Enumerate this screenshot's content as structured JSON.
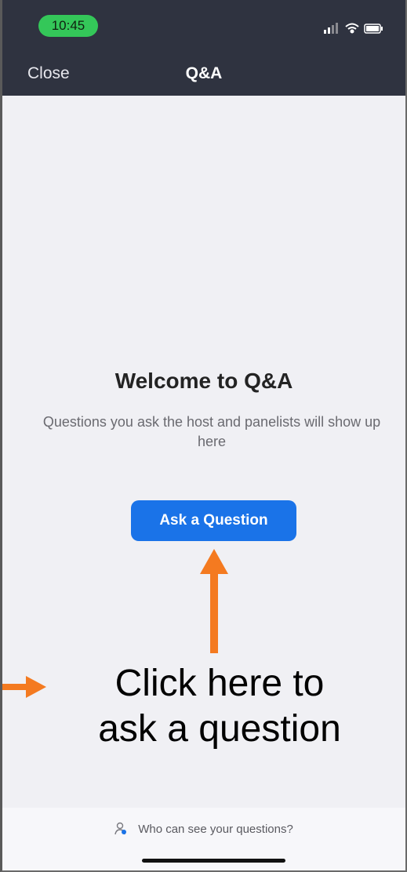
{
  "status_bar": {
    "time": "10:45",
    "icons": [
      "signal-icon",
      "wifi-icon",
      "battery-icon"
    ]
  },
  "nav": {
    "close_label": "Close",
    "title": "Q&A"
  },
  "empty_state": {
    "heading": "Welcome to Q&A",
    "description": "Questions you ask the host and panelists will show up here",
    "button_label": "Ask a Question"
  },
  "annotation": {
    "line1": "Click here to",
    "line2": "ask a question",
    "color": "#f47a20"
  },
  "footer": {
    "privacy_label": "Who can see your questions?",
    "icon": "person-icon"
  },
  "colors": {
    "header": "#2f3340",
    "accent": "#1a73e8",
    "time_pill": "#34c759"
  }
}
